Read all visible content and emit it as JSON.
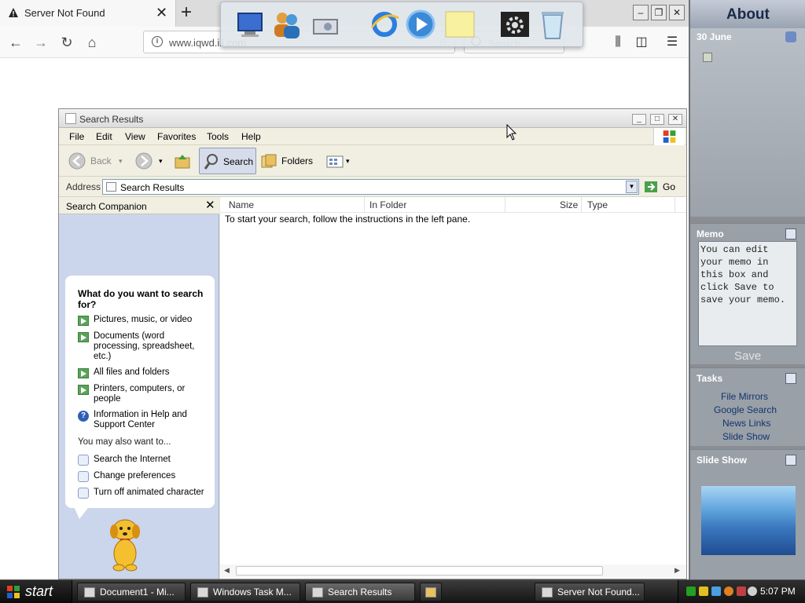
{
  "browser": {
    "tab_title": "Server Not Found",
    "new_tab": "+",
    "url": "www.iqwd.iii.com",
    "search_placeholder": "Search",
    "win_buttons": {
      "min": "–",
      "max": "❐",
      "close": "✕"
    }
  },
  "explorer": {
    "title": "Search Results",
    "menu": [
      "File",
      "Edit",
      "View",
      "Favorites",
      "Tools",
      "Help"
    ],
    "toolbar": {
      "back": "Back",
      "search": "Search",
      "folders": "Folders"
    },
    "address_label": "Address",
    "address_value": "Search Results",
    "go": "Go",
    "columns": [
      "Name",
      "In Folder",
      "Size",
      "Type"
    ],
    "content_message": "To start your search, follow the instructions in the left pane.",
    "companion": {
      "header": "Search Companion",
      "question": "What do you want to search for?",
      "options": [
        "Pictures, music, or video",
        "Documents (word processing, spreadsheet, etc.)",
        "All files and folders",
        "Printers, computers, or people",
        "Information in Help and Support Center"
      ],
      "also_label": "You may also want to...",
      "also_options": [
        "Search the Internet",
        "Change preferences",
        "Turn off animated character"
      ]
    }
  },
  "sidebar": {
    "about": "About",
    "date": "30 June",
    "memo_title": "Memo",
    "memo_text": "You can edit your memo in this box and click Save to save your memo.",
    "save": "Save",
    "tasks_title": "Tasks",
    "tasks": [
      "File Mirrors",
      "Google Search",
      "News Links",
      "Slide Show"
    ],
    "slideshow_title": "Slide Show"
  },
  "taskbar": {
    "start": "start",
    "items": [
      "Document1 - Mi...",
      "Windows Task M...",
      "Search Results",
      "Server Not Found..."
    ],
    "clock": "5:07 PM"
  }
}
